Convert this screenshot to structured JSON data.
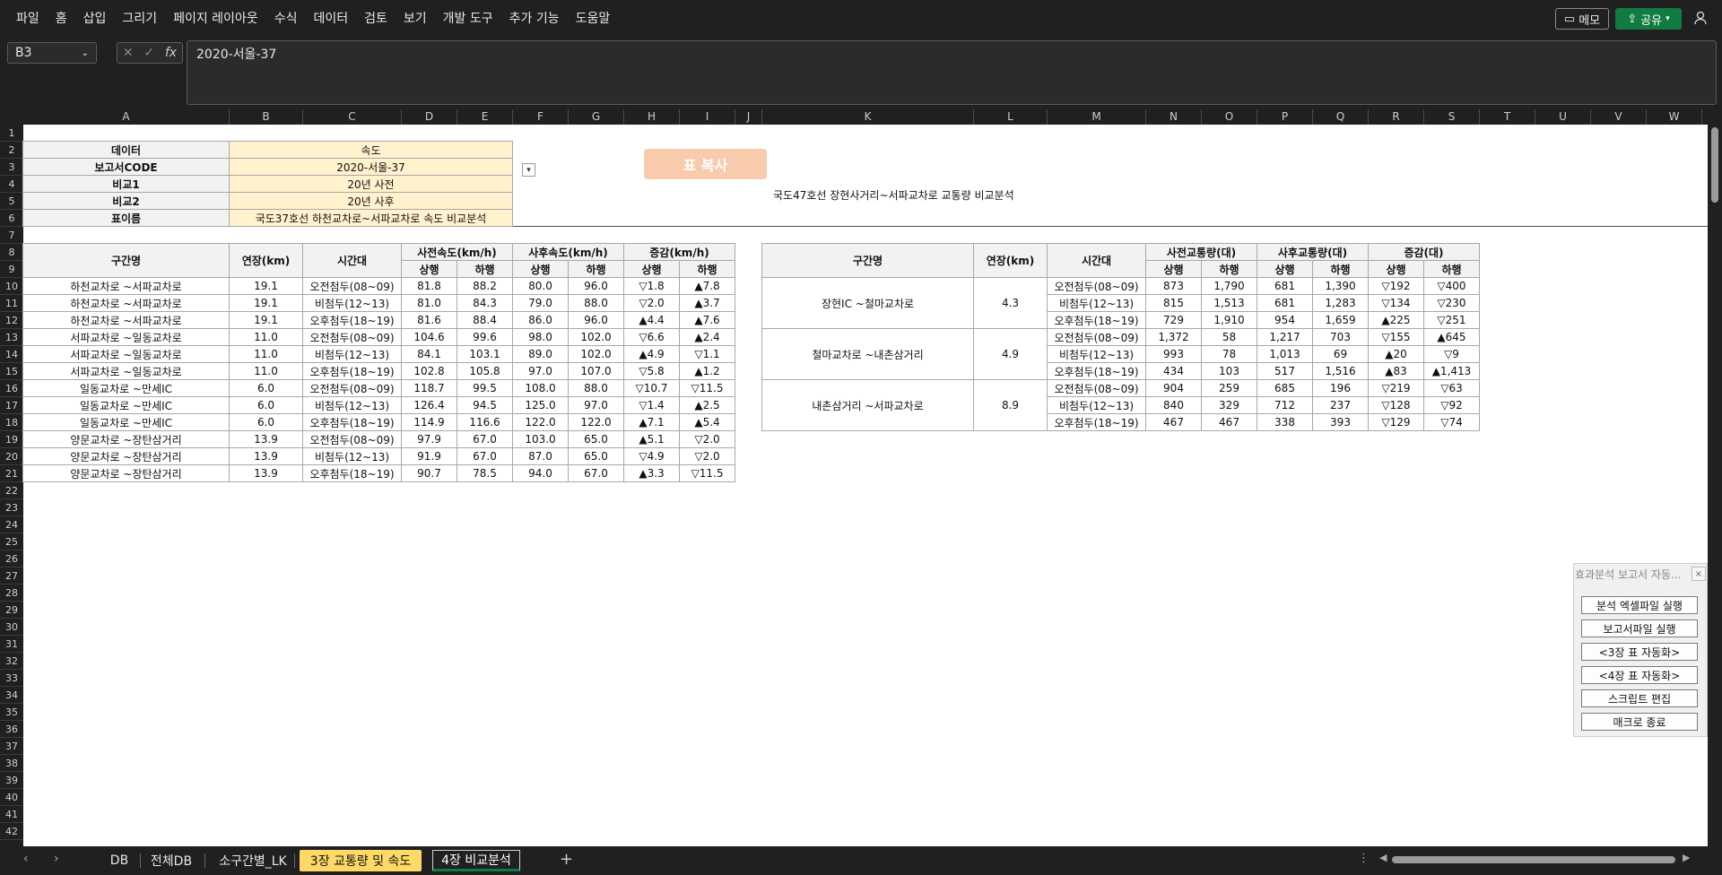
{
  "menu": [
    "파일",
    "홈",
    "삽입",
    "그리기",
    "페이지 레이아웃",
    "수식",
    "데이터",
    "검토",
    "보기",
    "개발 도구",
    "추가 기능",
    "도움말"
  ],
  "memo_label": "메모",
  "share_label": "공유",
  "namebox": "B3",
  "formula": "2020-서울-37",
  "columns": [
    "A",
    "B",
    "C",
    "D",
    "E",
    "F",
    "G",
    "H",
    "I",
    "J",
    "K",
    "L",
    "M",
    "N",
    "O",
    "P",
    "Q",
    "R",
    "S",
    "T",
    "U",
    "V",
    "W"
  ],
  "rows": [
    "1",
    "2",
    "3",
    "4",
    "5",
    "6",
    "7",
    "8",
    "9",
    "10",
    "11",
    "12",
    "13",
    "14",
    "15",
    "16",
    "17",
    "18",
    "19",
    "20",
    "21",
    "22",
    "23",
    "24",
    "25",
    "26",
    "27",
    "28",
    "29",
    "30",
    "31",
    "32",
    "33",
    "34",
    "35",
    "36",
    "37",
    "38",
    "39",
    "40",
    "41",
    "42"
  ],
  "info": [
    {
      "label": "데이터",
      "value": "속도"
    },
    {
      "label": "보고서CODE",
      "value": "2020-서울-37"
    },
    {
      "label": "비교1",
      "value": "20년 사전"
    },
    {
      "label": "비교2",
      "value": "20년 사후"
    },
    {
      "label": "표이름",
      "value": "국도37호선 하천교차로~서파교차로 속도 비교분석"
    }
  ],
  "copy_button": "표 복사",
  "dropdown_glyph": "▾",
  "table2_title": "국도47호선 장현사거리~서파교차로 교통량 비교분석",
  "t1": {
    "h_section": "구간명",
    "h_length": "연장(km)",
    "h_time": "시간대",
    "h_before": "사전속도(km/h)",
    "h_after": "사후속도(km/h)",
    "h_diff": "증감(km/h)",
    "h_up": "상행",
    "h_down": "하행",
    "rows": [
      [
        "하천교차로 ~서파교차로",
        "19.1",
        "오전첨두(08~09)",
        "81.8",
        "88.2",
        "80.0",
        "96.0",
        "▽1.8",
        "▲7.8"
      ],
      [
        "하천교차로 ~서파교차로",
        "19.1",
        "비첨두(12~13)",
        "81.0",
        "84.3",
        "79.0",
        "88.0",
        "▽2.0",
        "▲3.7"
      ],
      [
        "하천교차로 ~서파교차로",
        "19.1",
        "오후첨두(18~19)",
        "81.6",
        "88.4",
        "86.0",
        "96.0",
        "▲4.4",
        "▲7.6"
      ],
      [
        "서파교차로 ~일동교차로",
        "11.0",
        "오전첨두(08~09)",
        "104.6",
        "99.6",
        "98.0",
        "102.0",
        "▽6.6",
        "▲2.4"
      ],
      [
        "서파교차로 ~일동교차로",
        "11.0",
        "비첨두(12~13)",
        "84.1",
        "103.1",
        "89.0",
        "102.0",
        "▲4.9",
        "▽1.1"
      ],
      [
        "서파교차로 ~일동교차로",
        "11.0",
        "오후첨두(18~19)",
        "102.8",
        "105.8",
        "97.0",
        "107.0",
        "▽5.8",
        "▲1.2"
      ],
      [
        "일동교차로 ~만세IC",
        "6.0",
        "오전첨두(08~09)",
        "118.7",
        "99.5",
        "108.0",
        "88.0",
        "▽10.7",
        "▽11.5"
      ],
      [
        "일동교차로 ~만세IC",
        "6.0",
        "비첨두(12~13)",
        "126.4",
        "94.5",
        "125.0",
        "97.0",
        "▽1.4",
        "▲2.5"
      ],
      [
        "일동교차로 ~만세IC",
        "6.0",
        "오후첨두(18~19)",
        "114.9",
        "116.6",
        "122.0",
        "122.0",
        "▲7.1",
        "▲5.4"
      ],
      [
        "양문교차로 ~장탄삼거리",
        "13.9",
        "오전첨두(08~09)",
        "97.9",
        "67.0",
        "103.0",
        "65.0",
        "▲5.1",
        "▽2.0"
      ],
      [
        "양문교차로 ~장탄삼거리",
        "13.9",
        "비첨두(12~13)",
        "91.9",
        "67.0",
        "87.0",
        "65.0",
        "▽4.9",
        "▽2.0"
      ],
      [
        "양문교차로 ~장탄삼거리",
        "13.9",
        "오후첨두(18~19)",
        "90.7",
        "78.5",
        "94.0",
        "67.0",
        "▲3.3",
        "▽11.5"
      ]
    ]
  },
  "t2": {
    "h_section": "구간명",
    "h_length": "연장(km)",
    "h_time": "시간대",
    "h_before": "사전교통량(대)",
    "h_after": "사후교통량(대)",
    "h_diff": "증감(대)",
    "h_up": "상행",
    "h_down": "하행",
    "groups": [
      {
        "name": "장현IC ~철마교차로",
        "length": "4.3",
        "rows": [
          [
            "오전첨두(08~09)",
            "873",
            "1,790",
            "681",
            "1,390",
            "▽192",
            "▽400"
          ],
          [
            "비첨두(12~13)",
            "815",
            "1,513",
            "681",
            "1,283",
            "▽134",
            "▽230"
          ],
          [
            "오후첨두(18~19)",
            "729",
            "1,910",
            "954",
            "1,659",
            "▲225",
            "▽251"
          ]
        ]
      },
      {
        "name": "철마교차로 ~내촌삼거리",
        "length": "4.9",
        "rows": [
          [
            "오전첨두(08~09)",
            "1,372",
            "58",
            "1,217",
            "703",
            "▽155",
            "▲645"
          ],
          [
            "비첨두(12~13)",
            "993",
            "78",
            "1,013",
            "69",
            "▲20",
            "▽9"
          ],
          [
            "오후첨두(18~19)",
            "434",
            "103",
            "517",
            "1,516",
            "▲83",
            "▲1,413"
          ]
        ]
      },
      {
        "name": "내촌삼거리 ~서파교차로",
        "length": "8.9",
        "rows": [
          [
            "오전첨두(08~09)",
            "904",
            "259",
            "685",
            "196",
            "▽219",
            "▽63"
          ],
          [
            "비첨두(12~13)",
            "840",
            "329",
            "712",
            "237",
            "▽128",
            "▽92"
          ],
          [
            "오후첨두(18~19)",
            "467",
            "467",
            "338",
            "393",
            "▽129",
            "▽74"
          ]
        ]
      }
    ]
  },
  "macro": {
    "title": "효과분석 보고서 자동...",
    "close": "×",
    "buttons": [
      "분석 엑셀파일 실행",
      "보고서파일 실행",
      "<3장 표 자동화>",
      "<4장 표 자동화>",
      "스크립트 편집",
      "매크로 종료"
    ]
  },
  "tabs": [
    {
      "label": "DB",
      "style": "normal"
    },
    {
      "label": "전체DB",
      "style": "normal"
    },
    {
      "label": "소구간별_LK",
      "style": "normal"
    },
    {
      "label": "3장 교통량 및 속도",
      "style": "yellow"
    },
    {
      "label": "4장 비교분석",
      "style": "active"
    }
  ],
  "add_sheet": "+"
}
